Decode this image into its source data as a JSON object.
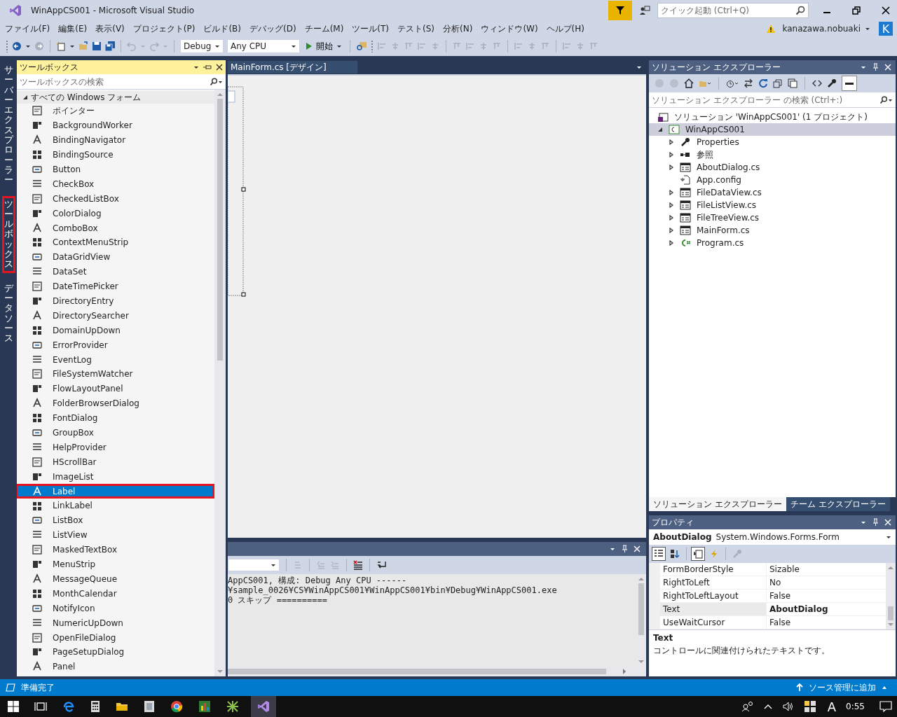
{
  "window": {
    "title": "WinAppCS001 - Microsoft Visual Studio",
    "quick_launch": {
      "placeholder": "クイック起動 (Ctrl+Q)"
    },
    "user": "kanazawa.nobuaki",
    "avatar": "K"
  },
  "menu": [
    "ファイル(F)",
    "編集(E)",
    "表示(V)",
    "プロジェクト(P)",
    "ビルド(B)",
    "デバッグ(D)",
    "チーム(M)",
    "ツール(T)",
    "テスト(S)",
    "分析(N)",
    "ウィンドウ(W)",
    "ヘルプ(H)"
  ],
  "toolbar": {
    "configuration": "Debug",
    "platform": "Any CPU",
    "start": "開始"
  },
  "side_tabs": [
    {
      "label": "サーバーエクスプローラー",
      "highlighted": false
    },
    {
      "label": "ツールボックス",
      "highlighted": true
    },
    {
      "label": "データソース",
      "highlighted": false
    }
  ],
  "toolbox": {
    "title": "ツールボックス",
    "search": {
      "placeholder": "ツールボックスの検索"
    },
    "group": {
      "label": "すべての Windows フォーム",
      "expanded": true
    },
    "items": [
      {
        "label": "ポインター",
        "selected": false,
        "highlighted": false
      },
      {
        "label": "BackgroundWorker",
        "selected": false,
        "highlighted": false
      },
      {
        "label": "BindingNavigator",
        "selected": false,
        "highlighted": false
      },
      {
        "label": "BindingSource",
        "selected": false,
        "highlighted": false
      },
      {
        "label": "Button",
        "selected": false,
        "highlighted": false
      },
      {
        "label": "CheckBox",
        "selected": false,
        "highlighted": false
      },
      {
        "label": "CheckedListBox",
        "selected": false,
        "highlighted": false
      },
      {
        "label": "ColorDialog",
        "selected": false,
        "highlighted": false
      },
      {
        "label": "ComboBox",
        "selected": false,
        "highlighted": false
      },
      {
        "label": "ContextMenuStrip",
        "selected": false,
        "highlighted": false
      },
      {
        "label": "DataGridView",
        "selected": false,
        "highlighted": false
      },
      {
        "label": "DataSet",
        "selected": false,
        "highlighted": false
      },
      {
        "label": "DateTimePicker",
        "selected": false,
        "highlighted": false
      },
      {
        "label": "DirectoryEntry",
        "selected": false,
        "highlighted": false
      },
      {
        "label": "DirectorySearcher",
        "selected": false,
        "highlighted": false
      },
      {
        "label": "DomainUpDown",
        "selected": false,
        "highlighted": false
      },
      {
        "label": "ErrorProvider",
        "selected": false,
        "highlighted": false
      },
      {
        "label": "EventLog",
        "selected": false,
        "highlighted": false
      },
      {
        "label": "FileSystemWatcher",
        "selected": false,
        "highlighted": false
      },
      {
        "label": "FlowLayoutPanel",
        "selected": false,
        "highlighted": false
      },
      {
        "label": "FolderBrowserDialog",
        "selected": false,
        "highlighted": false
      },
      {
        "label": "FontDialog",
        "selected": false,
        "highlighted": false
      },
      {
        "label": "GroupBox",
        "selected": false,
        "highlighted": false
      },
      {
        "label": "HelpProvider",
        "selected": false,
        "highlighted": false
      },
      {
        "label": "HScrollBar",
        "selected": false,
        "highlighted": false
      },
      {
        "label": "ImageList",
        "selected": false,
        "highlighted": false
      },
      {
        "label": "Label",
        "selected": true,
        "highlighted": true
      },
      {
        "label": "LinkLabel",
        "selected": false,
        "highlighted": false
      },
      {
        "label": "ListBox",
        "selected": false,
        "highlighted": false
      },
      {
        "label": "ListView",
        "selected": false,
        "highlighted": false
      },
      {
        "label": "MaskedTextBox",
        "selected": false,
        "highlighted": false
      },
      {
        "label": "MenuStrip",
        "selected": false,
        "highlighted": false
      },
      {
        "label": "MessageQueue",
        "selected": false,
        "highlighted": false
      },
      {
        "label": "MonthCalendar",
        "selected": false,
        "highlighted": false
      },
      {
        "label": "NotifyIcon",
        "selected": false,
        "highlighted": false
      },
      {
        "label": "NumericUpDown",
        "selected": false,
        "highlighted": false
      },
      {
        "label": "OpenFileDialog",
        "selected": false,
        "highlighted": false
      },
      {
        "label": "PageSetupDialog",
        "selected": false,
        "highlighted": false
      },
      {
        "label": "Panel",
        "selected": false,
        "highlighted": false
      }
    ]
  },
  "document": {
    "tab": "MainForm.cs [デザイン]"
  },
  "output": {
    "lines": [
      "AppCS001, 構成: Debug Any CPU ------",
      "¥sample_0026¥CS¥WinAppCS001¥WinAppCS001¥bin¥Debug¥WinAppCS001.exe",
      "0 スキップ =========="
    ]
  },
  "solution_explorer": {
    "title": "ソリューション エクスプローラー",
    "search": {
      "placeholder": "ソリューション エクスプローラー の検索 (Ctrl+:)"
    },
    "solution": "ソリューション 'WinAppCS001' (1 プロジェクト)",
    "project": {
      "label": "WinAppCS001",
      "expanded": true,
      "selected": true,
      "children": [
        {
          "label": "Properties",
          "expandable": true
        },
        {
          "label": "参照",
          "expandable": true
        },
        {
          "label": "AboutDialog.cs",
          "expandable": true
        },
        {
          "label": "App.config",
          "expandable": false
        },
        {
          "label": "FileDataView.cs",
          "expandable": true
        },
        {
          "label": "FileListView.cs",
          "expandable": true
        },
        {
          "label": "FileTreeView.cs",
          "expandable": true
        },
        {
          "label": "MainForm.cs",
          "expandable": true
        },
        {
          "label": "Program.cs",
          "expandable": true
        }
      ]
    },
    "tabs": [
      {
        "label": "ソリューション エクスプローラー",
        "selected": true
      },
      {
        "label": "チーム エクスプローラー",
        "selected": false
      }
    ]
  },
  "properties": {
    "title": "プロパティ",
    "object_name": "AboutDialog",
    "object_type": "System.Windows.Forms.Form",
    "rows": [
      {
        "name": "FormBorderStyle",
        "value": "Sizable",
        "selected": false
      },
      {
        "name": "RightToLeft",
        "value": "No",
        "selected": false
      },
      {
        "name": "RightToLeftLayout",
        "value": "False",
        "selected": false
      },
      {
        "name": "Text",
        "value": "AboutDialog",
        "selected": true
      },
      {
        "name": "UseWaitCursor",
        "value": "False",
        "selected": false
      }
    ],
    "description_title": "Text",
    "description": "コントロールに関連付けられたテキストです。"
  },
  "status_bar": {
    "text": "準備完了",
    "source_control": "ソース管理に追加"
  },
  "taskbar": {
    "ime": "A",
    "time": "0:55"
  }
}
